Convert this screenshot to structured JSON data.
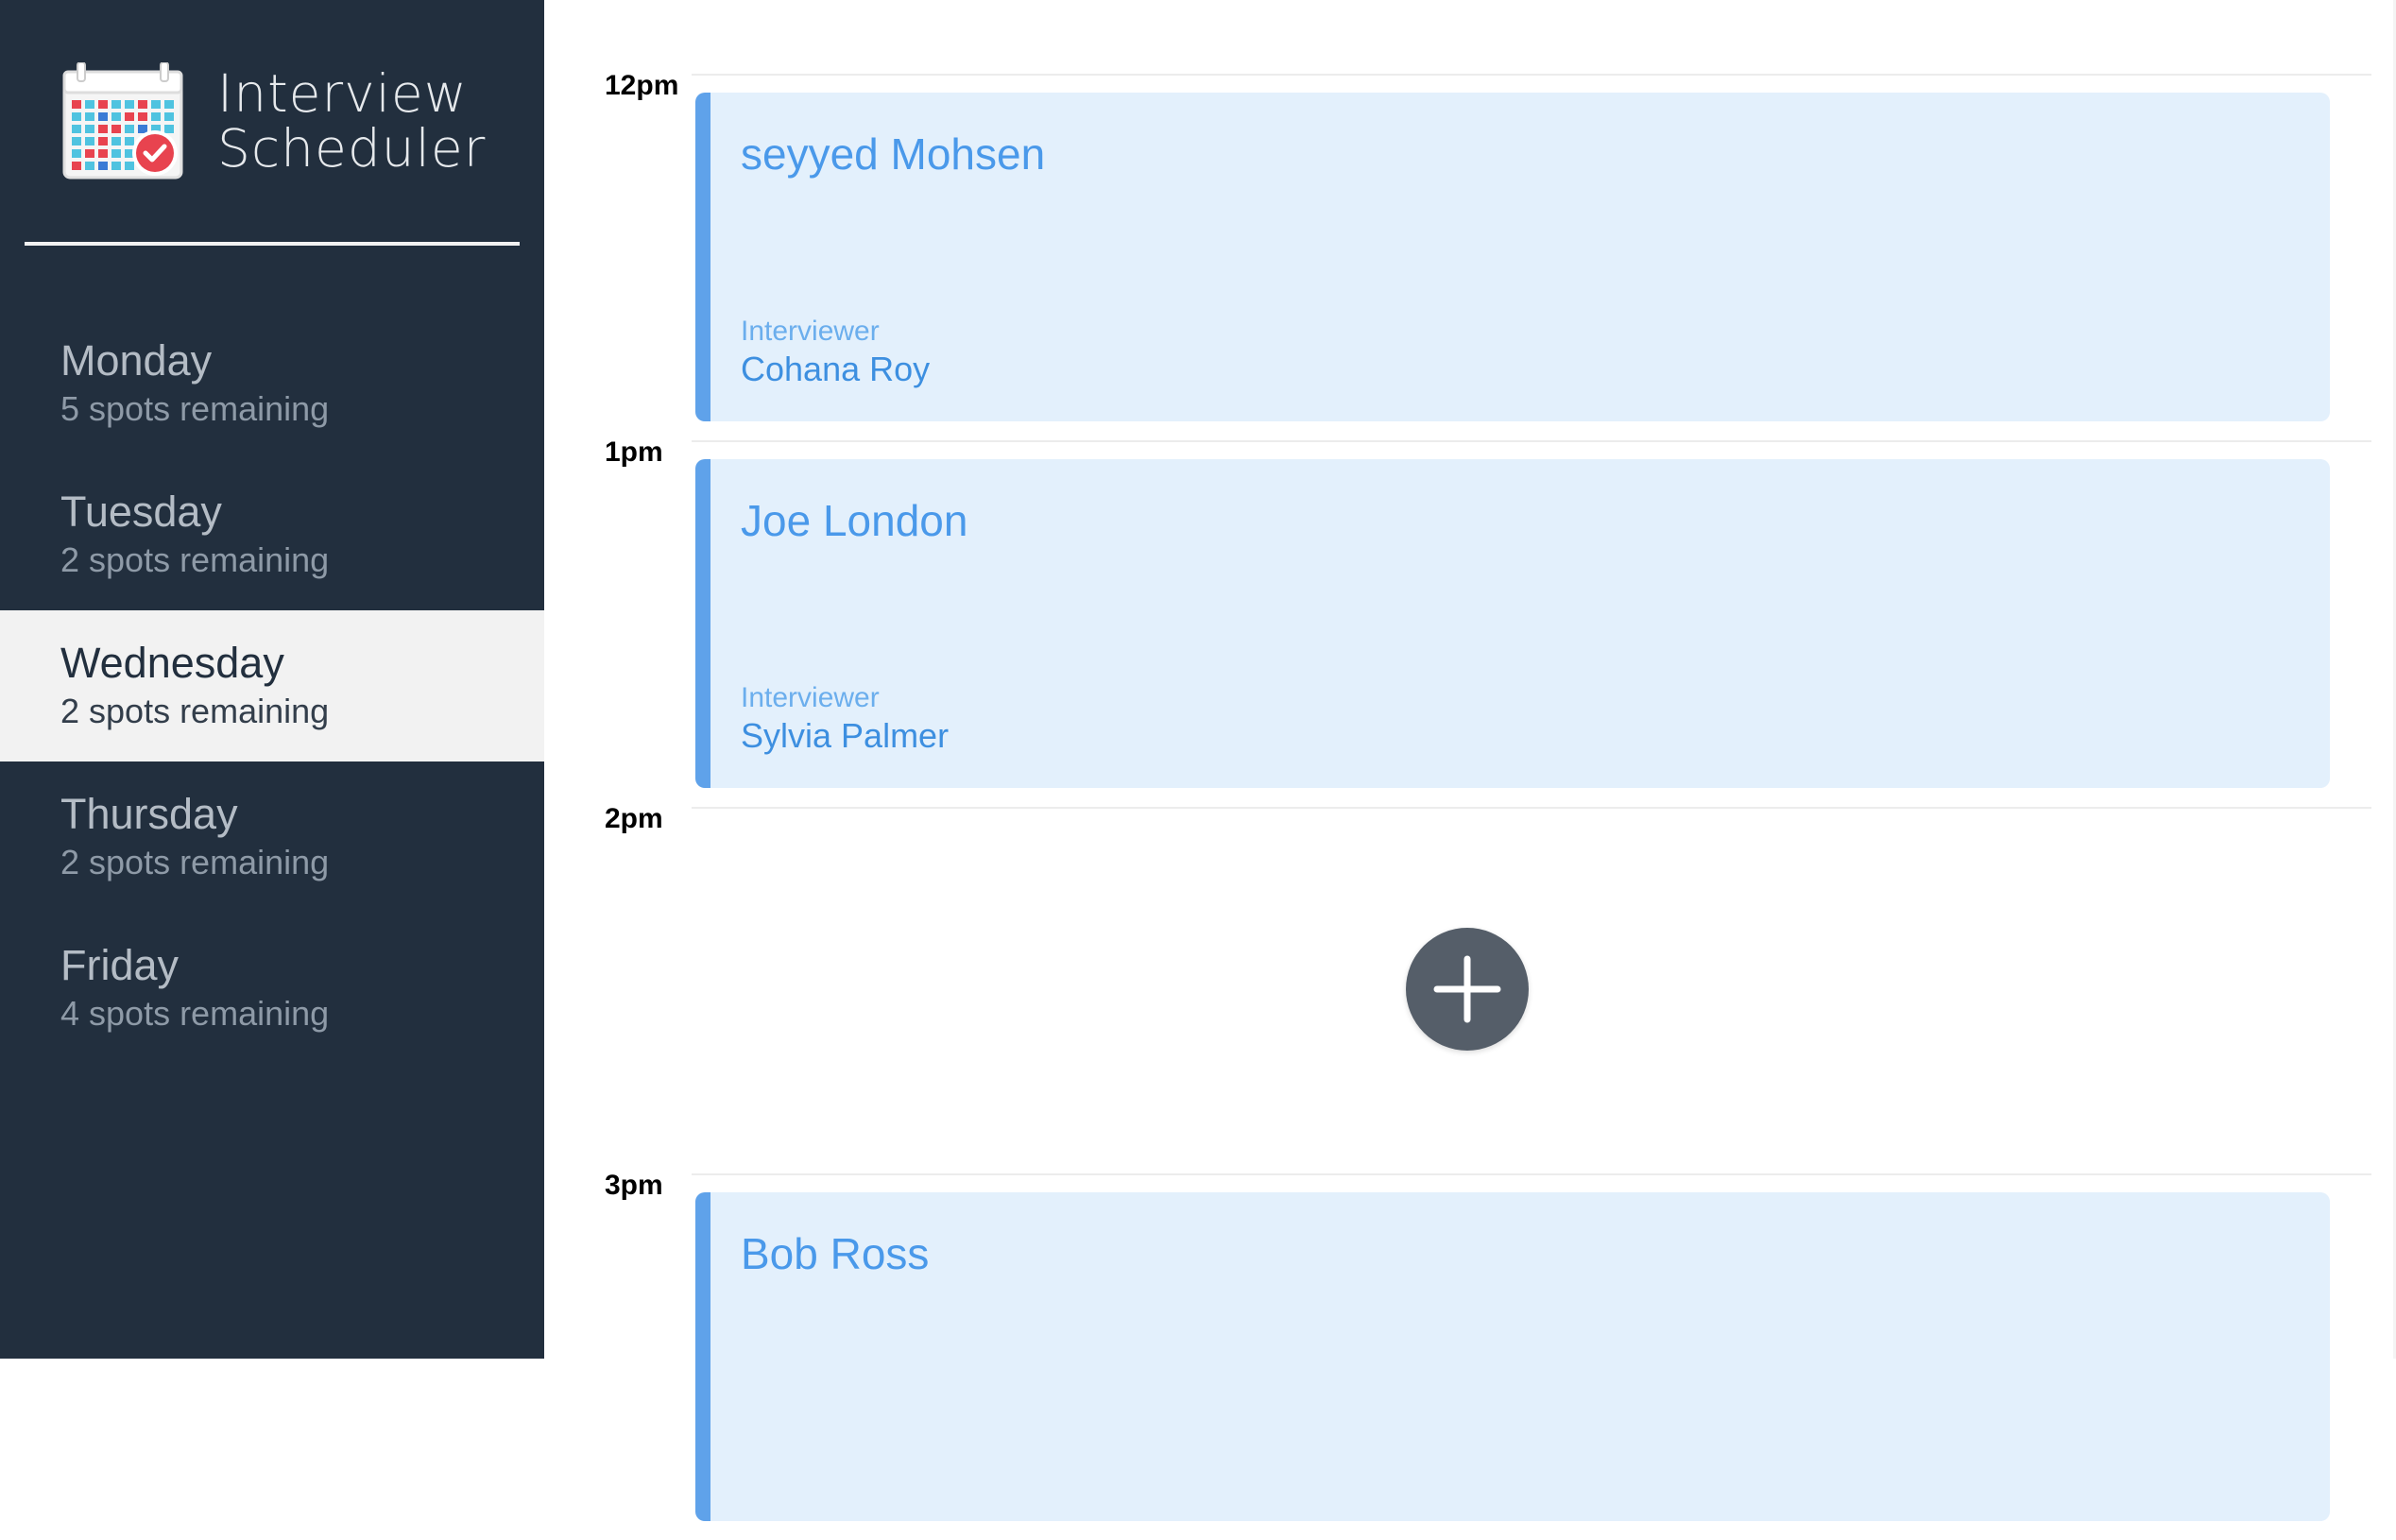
{
  "app": {
    "title_line1": "Interview",
    "title_line2": "Scheduler",
    "logo_icon": "calendar-check-icon"
  },
  "sidebar": {
    "days": [
      {
        "name": "Monday",
        "spots": "5 spots remaining",
        "selected": false
      },
      {
        "name": "Tuesday",
        "spots": "2 spots remaining",
        "selected": false
      },
      {
        "name": "Wednesday",
        "spots": "2 spots remaining",
        "selected": true
      },
      {
        "name": "Thursday",
        "spots": "2 spots remaining",
        "selected": false
      },
      {
        "name": "Friday",
        "spots": "4 spots remaining",
        "selected": false
      }
    ]
  },
  "schedule": {
    "slots": [
      {
        "time": "12pm",
        "student": "seyyed Mohsen",
        "interviewer_label": "Interviewer",
        "interviewer": "Cohana Roy"
      },
      {
        "time": "1pm",
        "student": "Joe London",
        "interviewer_label": "Interviewer",
        "interviewer": "Sylvia Palmer"
      },
      {
        "time": "2pm",
        "add_icon": "plus-icon"
      },
      {
        "time": "3pm",
        "student": "Bob Ross"
      }
    ]
  },
  "colors": {
    "sidebar_bg": "#222f3e",
    "appointment_bg": "#e3f0fc",
    "appointment_accent": "#5fa2ea",
    "add_button": "#555e69"
  }
}
